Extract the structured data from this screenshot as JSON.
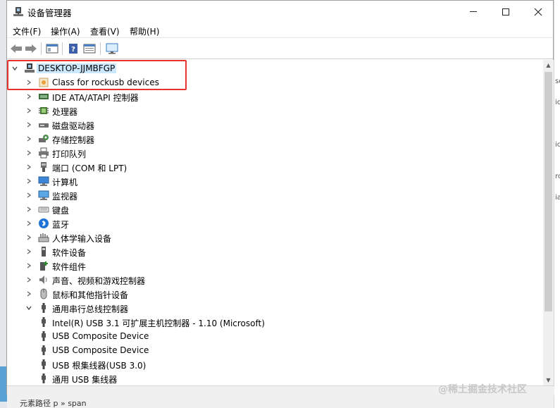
{
  "window": {
    "title": "设备管理器",
    "icon": "device-manager-icon"
  },
  "menubar": {
    "items": [
      "文件(F)",
      "操作(A)",
      "查看(V)",
      "帮助(H)"
    ]
  },
  "tree": {
    "root": "DESKTOP-JJMBFGP",
    "categories": [
      {
        "label": "Class for rockusb devices",
        "icon": "usb-class-icon"
      },
      {
        "label": "IDE ATA/ATAPI 控制器",
        "icon": "ide-controller-icon"
      },
      {
        "label": "处理器",
        "icon": "processor-icon"
      },
      {
        "label": "磁盘驱动器",
        "icon": "disk-drive-icon"
      },
      {
        "label": "存储控制器",
        "icon": "storage-controller-icon"
      },
      {
        "label": "打印队列",
        "icon": "printer-icon"
      },
      {
        "label": "端口 (COM 和 LPT)",
        "icon": "port-icon"
      },
      {
        "label": "计算机",
        "icon": "computer-icon"
      },
      {
        "label": "监视器",
        "icon": "monitor-icon"
      },
      {
        "label": "键盘",
        "icon": "keyboard-icon"
      },
      {
        "label": "蓝牙",
        "icon": "bluetooth-icon"
      },
      {
        "label": "人体学输入设备",
        "icon": "hid-icon"
      },
      {
        "label": "软件设备",
        "icon": "software-device-icon"
      },
      {
        "label": "软件组件",
        "icon": "software-component-icon"
      },
      {
        "label": "声音、视频和游戏控制器",
        "icon": "sound-icon"
      },
      {
        "label": "鼠标和其他指针设备",
        "icon": "mouse-icon"
      },
      {
        "label": "通用串行总线控制器",
        "icon": "usb-controller-icon"
      }
    ],
    "usb_children": [
      "Intel(R) USB 3.1 可扩展主机控制器 - 1.10 (Microsoft)",
      "USB Composite Device",
      "USB Composite Device",
      "USB 根集线器(USB 3.0)",
      "通用 USB 集线器"
    ]
  },
  "background": {
    "right_edge_text": [
      "se",
      "ic",
      "ic",
      "ro",
      "ia"
    ],
    "bottom_hint": "元素路径 p » span"
  },
  "watermark": "@稀土掘金技术社区",
  "colors": {
    "highlight_box": "#e8322e",
    "selection": "#cce8ff"
  }
}
